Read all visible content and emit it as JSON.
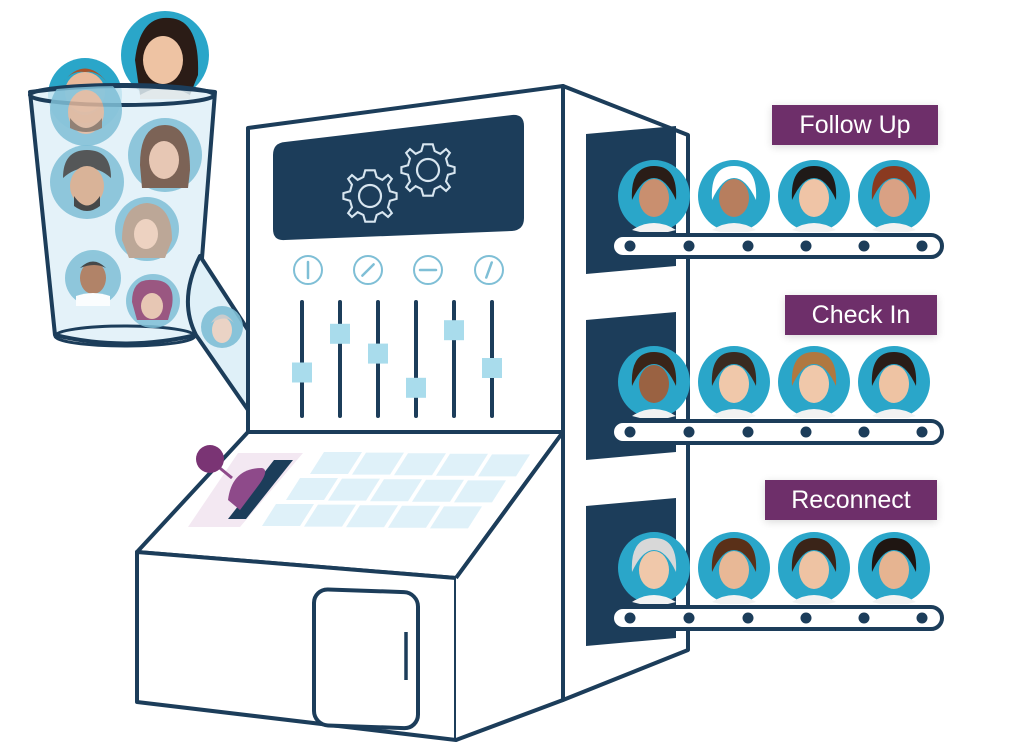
{
  "illustration": {
    "title": "Contact sorting machine",
    "colors": {
      "outline": "#1c3d5a",
      "panel": "#1c3d5a",
      "gear": "#d8e6f0",
      "glass": "#dff0f8",
      "avatar_ring": "#2aa6c9",
      "avatar_ring_muted": "#7fbfd6",
      "slider_knob": "#a9dcec",
      "keypad": "#dff1f9",
      "lever": "#7a3474",
      "lever_pad": "#f3e8f2",
      "label_bg": "#6e2f6a",
      "label_text": "#ffffff"
    },
    "sliders": {
      "levels": [
        0.35,
        0.78,
        0.56,
        0.18,
        0.82,
        0.4
      ]
    },
    "dials": [
      {
        "name": "dial-vertical"
      },
      {
        "name": "dial-diagonal-left"
      },
      {
        "name": "dial-horizontal"
      },
      {
        "name": "dial-diagonal-slight"
      }
    ],
    "cup": {
      "avatar_count": 8,
      "avatars_in_chute": 1
    },
    "conveyors": [
      {
        "label": "Follow Up",
        "avatar_count": 4
      },
      {
        "label": "Check In",
        "avatar_count": 4
      },
      {
        "label": "Reconnect",
        "avatar_count": 4
      }
    ]
  }
}
